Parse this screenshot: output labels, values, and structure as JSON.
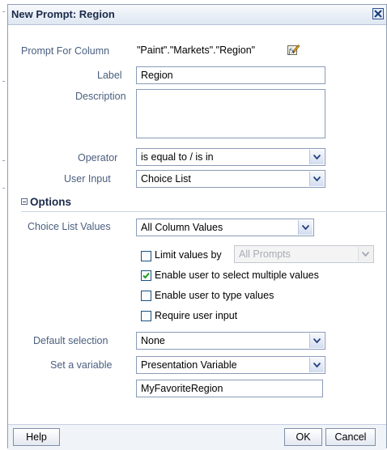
{
  "dialog": {
    "title": "New Prompt: Region",
    "close_icon": "close-x-icon"
  },
  "form": {
    "prompt_for_column_label": "Prompt For Column",
    "prompt_for_column_value": "\"Paint\".\"Markets\".\"Region\"",
    "edit_formula_icon": "edit-formula-icon",
    "label_label": "Label",
    "label_value": "Region",
    "description_label": "Description",
    "description_value": "",
    "operator_label": "Operator",
    "operator_value": "is equal to / is in",
    "user_input_label": "User Input",
    "user_input_value": "Choice List"
  },
  "options": {
    "heading": "Options",
    "choice_list_values_label": "Choice List Values",
    "choice_list_values_value": "All Column Values",
    "limit_values_by": {
      "label": "Limit values by",
      "checked": false,
      "value": "All Prompts",
      "disabled": true
    },
    "multi_select": {
      "label": "Enable user to select multiple values",
      "checked": true
    },
    "type_values": {
      "label": "Enable user to type values",
      "checked": false
    },
    "require_input": {
      "label": "Require user input",
      "checked": false
    },
    "default_selection_label": "Default selection",
    "default_selection_value": "None",
    "set_variable_label": "Set a variable",
    "set_variable_value": "Presentation Variable",
    "variable_name_value": "MyFavoriteRegion"
  },
  "footer": {
    "help_label": "Help",
    "ok_label": "OK",
    "cancel_label": "Cancel"
  },
  "colors": {
    "label_text": "#4a5e7e",
    "border": "#8a9bb7",
    "title_text": "#1b2a4a"
  }
}
